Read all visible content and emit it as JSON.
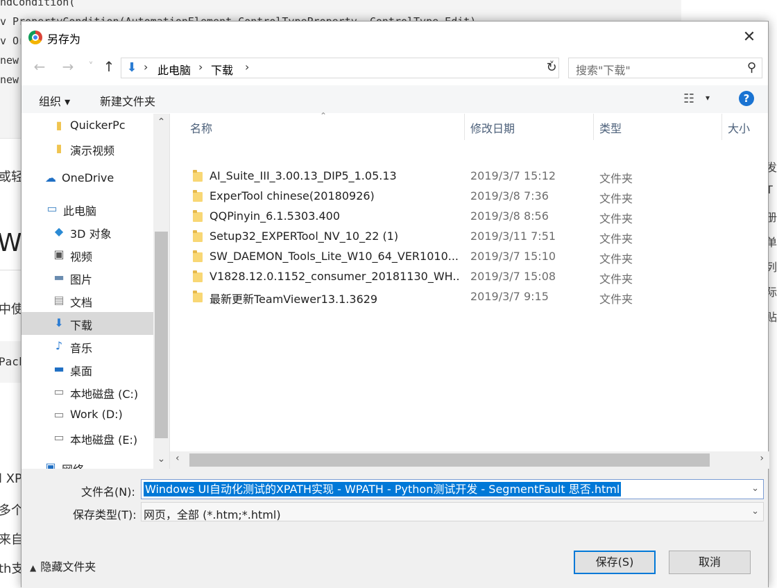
{
  "background": {
    "code_lines": [
      "ndCondition(",
      "v PropertyCondition(AutomationElement.ControlTypeProperty, ControlType.Edit)",
      "v Or",
      "new",
      "new"
    ],
    "left_texts": [
      "或轻",
      "W",
      "中使",
      "Pack",
      "l XP",
      "多个",
      "来自",
      "th支"
    ],
    "right_texts": [
      "发",
      "T",
      "册",
      "单",
      "列",
      "际",
      "贴"
    ]
  },
  "dialog": {
    "title": "另存为",
    "close_glyph": "✕"
  },
  "nav": {
    "back_glyph": "←",
    "forward_glyph": "→",
    "recent_glyph": "˅",
    "up_glyph": "↑",
    "address_icon": "download-arrow-icon",
    "breadcrumb": [
      "此电脑",
      "下载"
    ],
    "refresh_glyph": "↻",
    "search_placeholder": "搜索\"下载\""
  },
  "toolbar": {
    "organize": "组织 ▾",
    "new_folder": "新建文件夹",
    "help": "?"
  },
  "sidebar": {
    "items": [
      {
        "label": "QuickerPc",
        "icon": "folder-icon"
      },
      {
        "label": "演示视频",
        "icon": "folder-icon"
      },
      {
        "label": "OneDrive",
        "icon": "cloud-icon"
      },
      {
        "label": "此电脑",
        "icon": "computer-icon"
      },
      {
        "label": "3D 对象",
        "icon": "cube-icon"
      },
      {
        "label": "视频",
        "icon": "video-icon"
      },
      {
        "label": "图片",
        "icon": "picture-icon"
      },
      {
        "label": "文档",
        "icon": "document-icon"
      },
      {
        "label": "下载",
        "icon": "download-icon"
      },
      {
        "label": "音乐",
        "icon": "music-icon"
      },
      {
        "label": "桌面",
        "icon": "desktop-icon"
      },
      {
        "label": "本地磁盘 (C:)",
        "icon": "drive-icon"
      },
      {
        "label": "Work (D:)",
        "icon": "drive-icon"
      },
      {
        "label": "本地磁盘 (E:)",
        "icon": "drive-icon"
      },
      {
        "label": "网络",
        "icon": "network-icon"
      }
    ],
    "selected": "下载"
  },
  "columns": {
    "name": "名称",
    "date": "修改日期",
    "type": "类型",
    "size": "大小"
  },
  "files": [
    {
      "name": "AI_Suite_III_3.00.13_DIP5_1.05.13",
      "date": "2019/3/7 15:12",
      "type": "文件夹"
    },
    {
      "name": "ExperTool chinese(20180926)",
      "date": "2019/3/8 7:36",
      "type": "文件夹"
    },
    {
      "name": "QQPinyin_6.1.5303.400",
      "date": "2019/3/8 8:56",
      "type": "文件夹"
    },
    {
      "name": "Setup32_EXPERTool_NV_10_22 (1)",
      "date": "2019/3/11 7:51",
      "type": "文件夹"
    },
    {
      "name": "SW_DAEMON_Tools_Lite_W10_64_VER1010...",
      "date": "2019/3/7 15:10",
      "type": "文件夹"
    },
    {
      "name": "V1828.12.0.1152_consumer_20181130_WH...",
      "date": "2019/3/7 15:08",
      "type": "文件夹"
    },
    {
      "name": "最新更新TeamViewer13.1.3629",
      "date": "2019/3/7 9:15",
      "type": "文件夹"
    }
  ],
  "form": {
    "filename_label": "文件名(N):",
    "filename_value": "Windows UI自动化测试的XPATH实现 - WPATH - Python测试开发 - SegmentFault 思否.html",
    "filetype_label": "保存类型(T):",
    "filetype_value": "网页，全部 (*.htm;*.html)",
    "hide_folders": "隐藏文件夹",
    "save": "保存(S)",
    "cancel": "取消"
  },
  "colors": {
    "accent": "#0078d7",
    "help": "#1a73d2",
    "folder": "#f8d775",
    "selected_row": "#d9d9d9"
  }
}
